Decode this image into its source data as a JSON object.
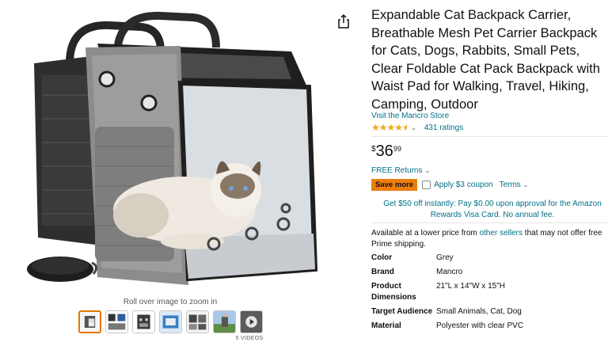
{
  "product": {
    "title": "Expandable Cat Backpack Carrier, Breathable Mesh Pet Carrier Backpack for Cats, Dogs, Rabbits, Small Pets, Clear Foldable Cat Pack Backpack with Waist Pad for Walking, Travel, Hiking, Camping, Outdoor",
    "store_link": "Visit the Mancro Store",
    "rating": 4.5,
    "stars_icon": "star-rating-icon",
    "ratings_count": "431 ratings"
  },
  "price": {
    "symbol": "$",
    "whole": "36",
    "fraction": "99"
  },
  "returns": {
    "label": "FREE Returns"
  },
  "deal": {
    "badge": "Save more",
    "coupon_label": "Apply $3 coupon",
    "terms_label": "Terms"
  },
  "promo": {
    "text": "Get $50 off instantly: Pay $0.00 upon approval for the Amazon Rewards Visa Card. No annual fee."
  },
  "availability": {
    "prefix": "Available at a lower price from",
    "link": "other sellers",
    "suffix": "that may not offer free Prime shipping."
  },
  "specs": [
    {
      "key": "Color",
      "value": "Grey"
    },
    {
      "key": "Brand",
      "value": "Mancro"
    },
    {
      "key": "Product Dimensions",
      "value": "21\"L x 14\"W x 15\"H"
    },
    {
      "key": "Target Audience",
      "value": "Small Animals, Cat, Dog"
    },
    {
      "key": "Material",
      "value": "Polyester with clear PVC"
    }
  ],
  "gallery": {
    "zoom_hint": "Roll over image to zoom in",
    "videos_label": "5 VIDEOS",
    "thumbnail_count": 7,
    "active_index": 0
  },
  "colors": {
    "link": "#007185",
    "star": "#f2a71b",
    "badge": "#ed7d0f",
    "active_thumb": "#e77600"
  }
}
